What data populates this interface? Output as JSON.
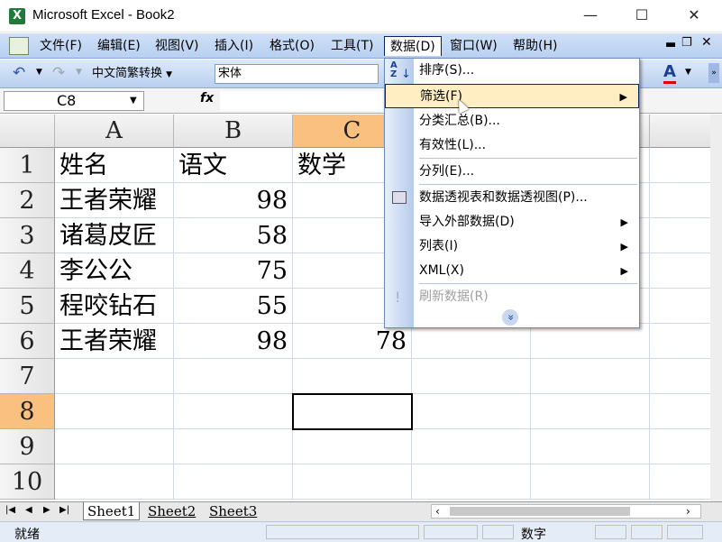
{
  "window": {
    "title": "Microsoft Excel - Book2",
    "min": "—",
    "max": "☐",
    "close": "✕"
  },
  "menu": [
    "文件(F)",
    "编辑(E)",
    "视图(V)",
    "插入(I)",
    "格式(O)",
    "工具(T)",
    "数据(D)",
    "窗口(W)",
    "帮助(H)"
  ],
  "toolbar": {
    "convert_label": "中文简繁转换",
    "font_name": "宋体"
  },
  "namebox": "C8",
  "fx": "fx",
  "columns": [
    "A",
    "B",
    "C"
  ],
  "rows": [
    "1",
    "2",
    "3",
    "4",
    "5",
    "6",
    "7",
    "8",
    "9",
    "10"
  ],
  "table": [
    [
      "姓名",
      "语文",
      "数学"
    ],
    [
      "王者荣耀",
      "98",
      ""
    ],
    [
      "诸葛皮匠",
      "58",
      ""
    ],
    [
      "李公公",
      "75",
      ""
    ],
    [
      "程咬钻石",
      "55",
      ""
    ],
    [
      "王者荣耀",
      "98",
      "78"
    ]
  ],
  "sheets": [
    "Sheet1",
    "Sheet2",
    "Sheet3"
  ],
  "status": {
    "ready": "就绪",
    "numlock": "数字"
  },
  "data_menu": {
    "items": [
      {
        "label": "排序(S)...",
        "icon": "sort-az-icon"
      },
      {
        "label": "筛选(F)",
        "submenu": true,
        "highlight": true
      },
      {
        "label": "分类汇总(B)..."
      },
      {
        "label": "有效性(L)..."
      },
      {
        "label": "分列(E)..."
      },
      {
        "label": "数据透视表和数据透视图(P)...",
        "icon": "pivot-table-icon"
      },
      {
        "label": "导入外部数据(D)",
        "submenu": true
      },
      {
        "label": "列表(I)",
        "submenu": true
      },
      {
        "label": "XML(X)",
        "submenu": true
      },
      {
        "label": "刷新数据(R)",
        "disabled": true,
        "icon": "refresh-icon"
      }
    ],
    "expand": "»"
  },
  "colors": {
    "accent": "#f9c080",
    "menu_highlight": "#ffeec2"
  }
}
